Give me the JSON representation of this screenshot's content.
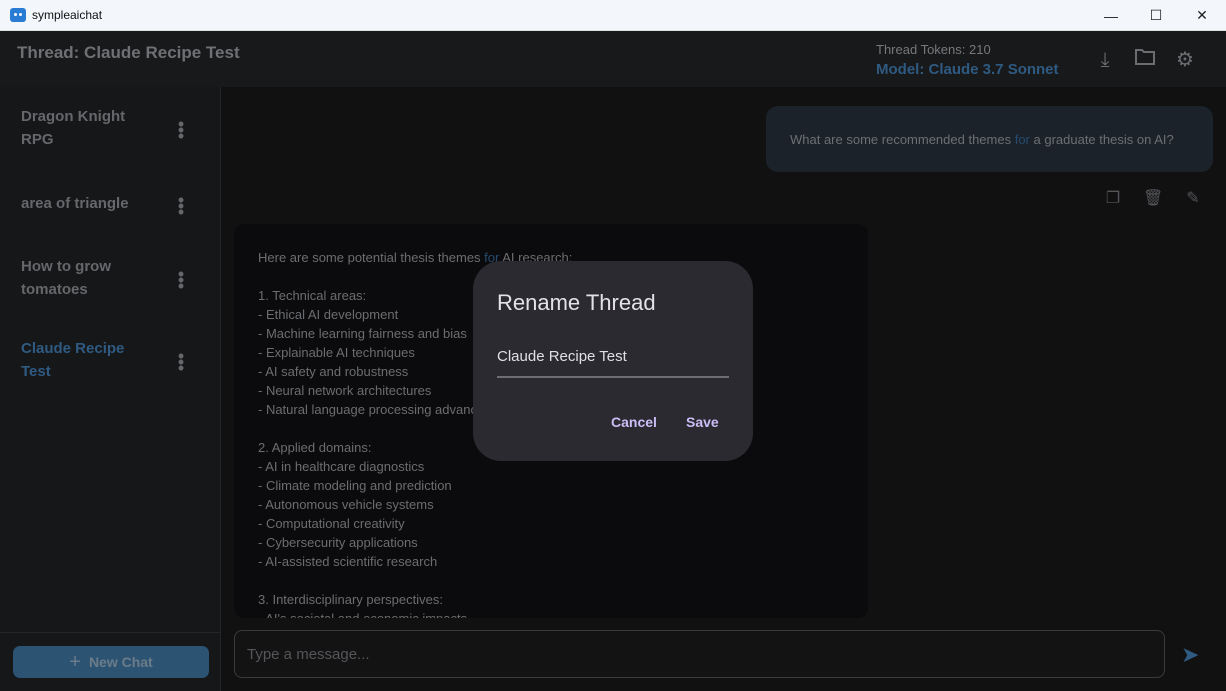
{
  "window": {
    "title": "sympleaichat",
    "minimize": "—",
    "maximize": "☐",
    "close": "✕"
  },
  "header": {
    "thread_title": "Thread: Claude Recipe Test",
    "tokens": "Thread Tokens: 210",
    "model": "Model: Claude 3.7 Sonnet"
  },
  "sidebar": {
    "threads": [
      {
        "l1": "Dragon Knight",
        "l2": "RPG"
      },
      {
        "l1": "area of triangle",
        "l2": ""
      },
      {
        "l1": "How to grow",
        "l2": "tomatoes"
      },
      {
        "l1": "Claude Recipe",
        "l2": "Test"
      }
    ],
    "new_chat": "New Chat"
  },
  "chat": {
    "user_message": {
      "pre": "What are some recommended themes ",
      "kw": "for",
      "post": " a graduate thesis on AI?"
    },
    "assistant_first": {
      "pre": "Here are some potential thesis themes ",
      "kw": "for",
      "post": " AI research:"
    },
    "assistant_body": "\n1. Technical areas:\n- Ethical AI development\n- Machine learning fairness and bias\n- Explainable AI techniques\n- AI safety and robustness\n- Neural network architectures\n- Natural language processing advancements\n\n2. Applied domains:\n- AI in healthcare diagnostics\n- Climate modeling and prediction\n- Autonomous vehicle systems\n- Computational creativity\n- Cybersecurity applications\n- AI-assisted scientific research\n\n3. Interdisciplinary perspectives:\n- AI's societal and economic impacts"
  },
  "input": {
    "placeholder": "Type a message..."
  },
  "dialog": {
    "title": "Rename Thread",
    "value": "Claude Recipe Test",
    "cancel": "Cancel",
    "save": "Save"
  }
}
